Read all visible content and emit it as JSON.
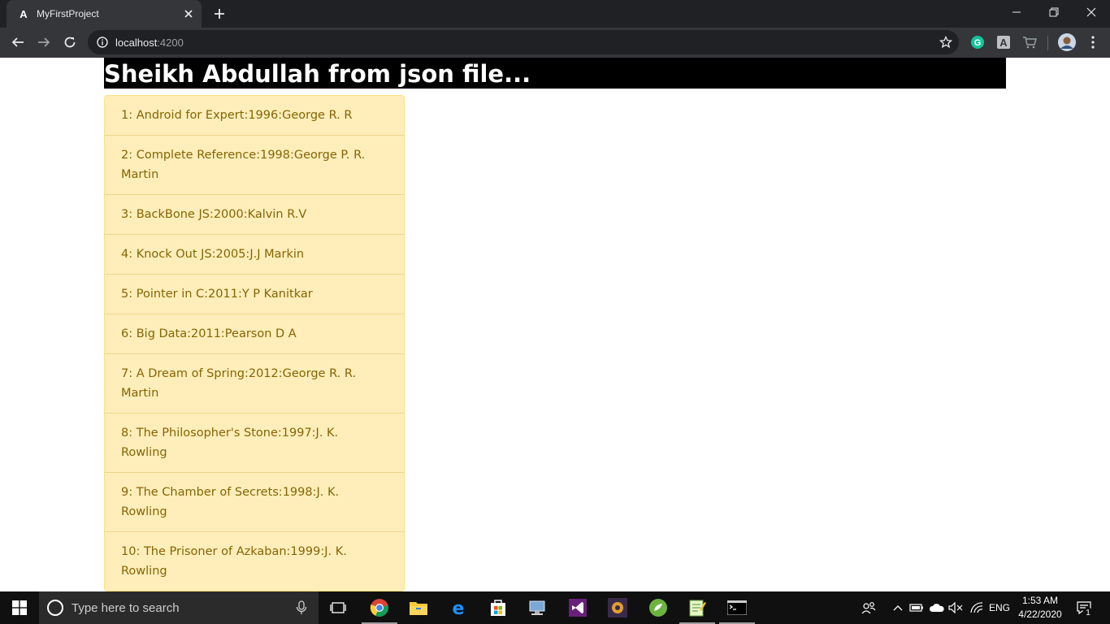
{
  "browser": {
    "tab": {
      "title": "MyFirstProject"
    },
    "address": {
      "host": "localhost",
      "port": ":4200"
    }
  },
  "page": {
    "heading": "Sheikh Abdullah from json file...",
    "books": [
      {
        "text": "1: Android for Expert:1996:George R. R"
      },
      {
        "text": "2: Complete Reference:1998:George P. R. Martin"
      },
      {
        "text": "3: BackBone JS:2000:Kalvin R.V"
      },
      {
        "text": "4: Knock Out JS:2005:J.J Markin"
      },
      {
        "text": "5: Pointer in C:2011:Y P Kanitkar"
      },
      {
        "text": "6: Big Data:2011:Pearson D A"
      },
      {
        "text": "7: A Dream of Spring:2012:George R. R. Martin"
      },
      {
        "text": "8: The Philosopher's Stone:1997:J. K. Rowling"
      },
      {
        "text": "9: The Chamber of Secrets:1998:J. K. Rowling"
      },
      {
        "text": "10: The Prisoner of Azkaban:1999:J. K. Rowling"
      }
    ]
  },
  "taskbar": {
    "search_placeholder": "Type here to search",
    "language": "ENG",
    "time": "1:53 AM",
    "date": "4/22/2020",
    "notification_count": "1"
  },
  "colors": {
    "list_bg": "#ffeeba",
    "list_text": "#856404",
    "heading_bg": "#000000"
  }
}
